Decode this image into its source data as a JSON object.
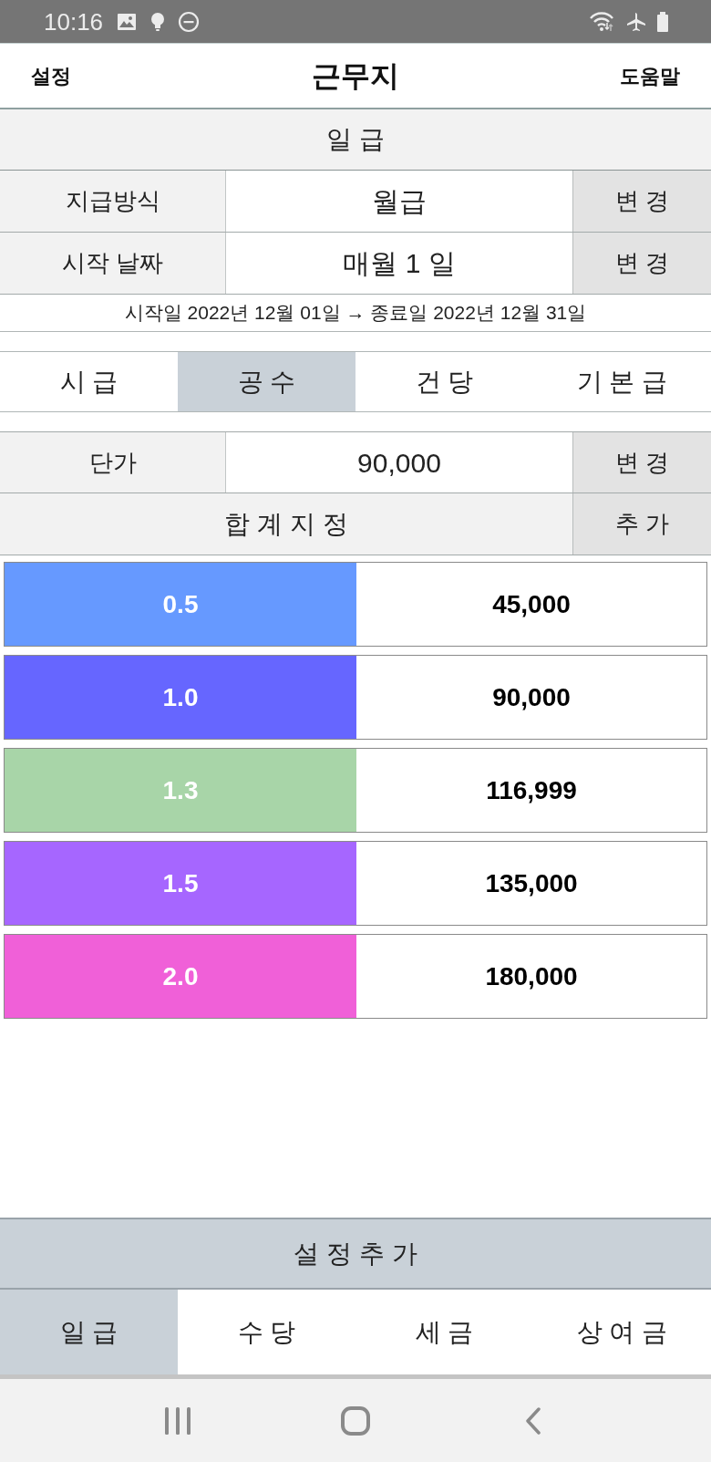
{
  "status_bar": {
    "time": "10:16"
  },
  "header": {
    "left_button": "설정",
    "title": "근무지",
    "right_button": "도움말"
  },
  "section_title": "일 급",
  "settings_rows": [
    {
      "label": "지급방식",
      "value": "월급",
      "button": "변 경"
    },
    {
      "label": "시작 날짜",
      "value": "매월 1 일",
      "button": "변 경"
    }
  ],
  "period_text": "시작일 2022년 12월 01일 → 종료일 2022년 12월 31일",
  "tabs": [
    {
      "label": "시 급",
      "selected": false
    },
    {
      "label": "공 수",
      "selected": true
    },
    {
      "label": "건 당",
      "selected": false
    },
    {
      "label": "기 본 급",
      "selected": false
    }
  ],
  "unit_price": {
    "label": "단가",
    "value": "90,000",
    "button": "변 경"
  },
  "total_row": {
    "label": "합 계 지 정",
    "button": "추 가"
  },
  "multipliers": [
    {
      "factor": "0.5",
      "amount": "45,000",
      "color": "#6699ff"
    },
    {
      "factor": "1.0",
      "amount": "90,000",
      "color": "#6666ff"
    },
    {
      "factor": "1.3",
      "amount": "116,999",
      "color": "#a8d5a8"
    },
    {
      "factor": "1.5",
      "amount": "135,000",
      "color": "#a666ff"
    },
    {
      "factor": "2.0",
      "amount": "180,000",
      "color": "#f060d8"
    }
  ],
  "add_settings_button": "설 정 추 가",
  "bottom_tabs": [
    {
      "label": "일 급",
      "selected": true
    },
    {
      "label": "수 당",
      "selected": false
    },
    {
      "label": "세 금",
      "selected": false
    },
    {
      "label": "상 여 금",
      "selected": false
    }
  ]
}
